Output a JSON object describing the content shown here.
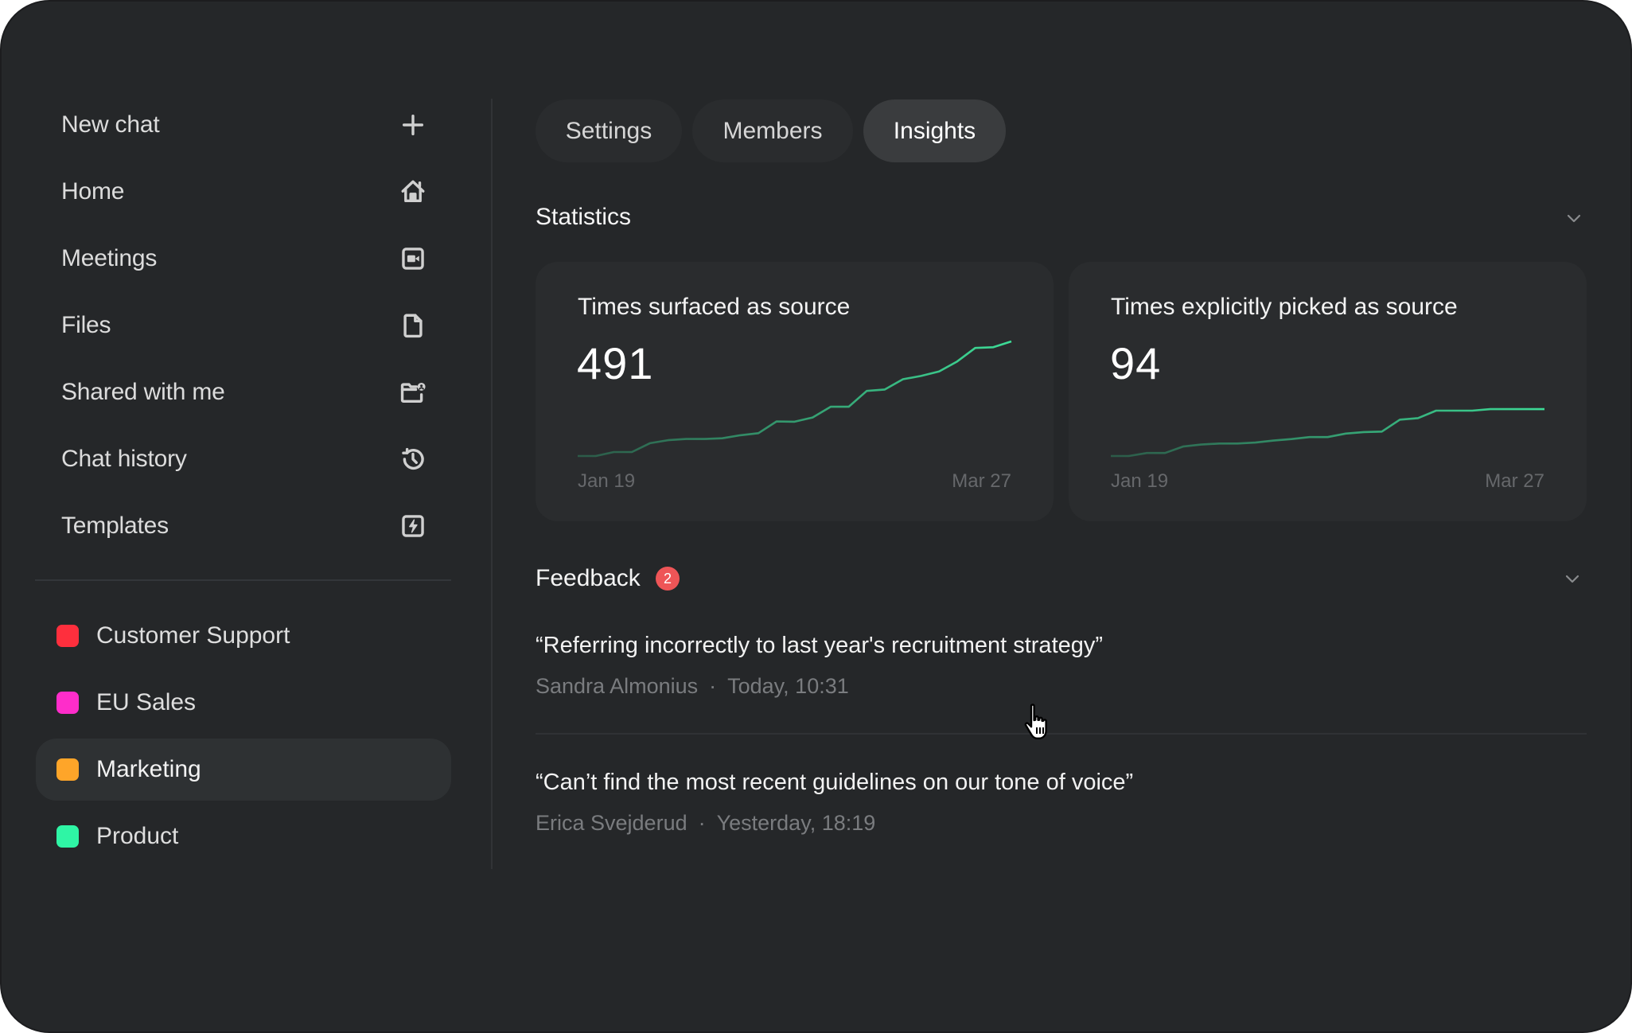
{
  "sidebar": {
    "nav": [
      {
        "label": "New chat",
        "icon": "plus-icon"
      },
      {
        "label": "Home",
        "icon": "home-icon"
      },
      {
        "label": "Meetings",
        "icon": "video-camera-icon"
      },
      {
        "label": "Files",
        "icon": "file-icon"
      },
      {
        "label": "Shared with me",
        "icon": "shared-folder-icon"
      },
      {
        "label": "Chat history",
        "icon": "history-icon"
      },
      {
        "label": "Templates",
        "icon": "lightning-template-icon"
      }
    ],
    "projects": [
      {
        "label": "Customer Support",
        "color": "#fe2f3d",
        "active": false
      },
      {
        "label": "EU Sales",
        "color": "#fe2dca",
        "active": false
      },
      {
        "label": "Marketing",
        "color": "#fea529",
        "active": true
      },
      {
        "label": "Product",
        "color": "#2ff5a5",
        "active": false
      }
    ]
  },
  "tabs": [
    {
      "label": "Settings",
      "active": false
    },
    {
      "label": "Members",
      "active": false
    },
    {
      "label": "Insights",
      "active": true
    }
  ],
  "statistics": {
    "title": "Statistics",
    "accent_color": "#3ddc97"
  },
  "chart_data": [
    {
      "type": "line",
      "title": "Times surfaced as source",
      "total": "491",
      "x_start_label": "Jan 19",
      "x_end_label": "Mar 27",
      "values": [
        0,
        0,
        17,
        17,
        55,
        68,
        73,
        73,
        76,
        89,
        98,
        148,
        147,
        165,
        211,
        211,
        279,
        285,
        329,
        343,
        362,
        405,
        463,
        466,
        491
      ],
      "ylim": [
        0,
        491
      ],
      "grid": false
    },
    {
      "type": "line",
      "title": "Times explicitly picked as source",
      "total": "94",
      "x_start_label": "Jan 19",
      "x_end_label": "Mar 27",
      "values": [
        0,
        0,
        6,
        6,
        19,
        23,
        25,
        25,
        27,
        31,
        34,
        38,
        38,
        45,
        48,
        49,
        73,
        76,
        91,
        91,
        91,
        94,
        94,
        94,
        94
      ],
      "ylim": [
        0,
        230
      ],
      "grid": false
    }
  ],
  "feedback": {
    "title": "Feedback",
    "count": "2",
    "items": [
      {
        "quote": "“Referring incorrectly to last year's recruitment strategy”",
        "author": "Sandra Almonius",
        "separator": "·",
        "time": "Today, 10:31"
      },
      {
        "quote": "“Can’t find the most recent guidelines on our tone of voice”",
        "author": "Erica Svejderud",
        "separator": "·",
        "time": "Yesterday, 18:19"
      }
    ]
  }
}
